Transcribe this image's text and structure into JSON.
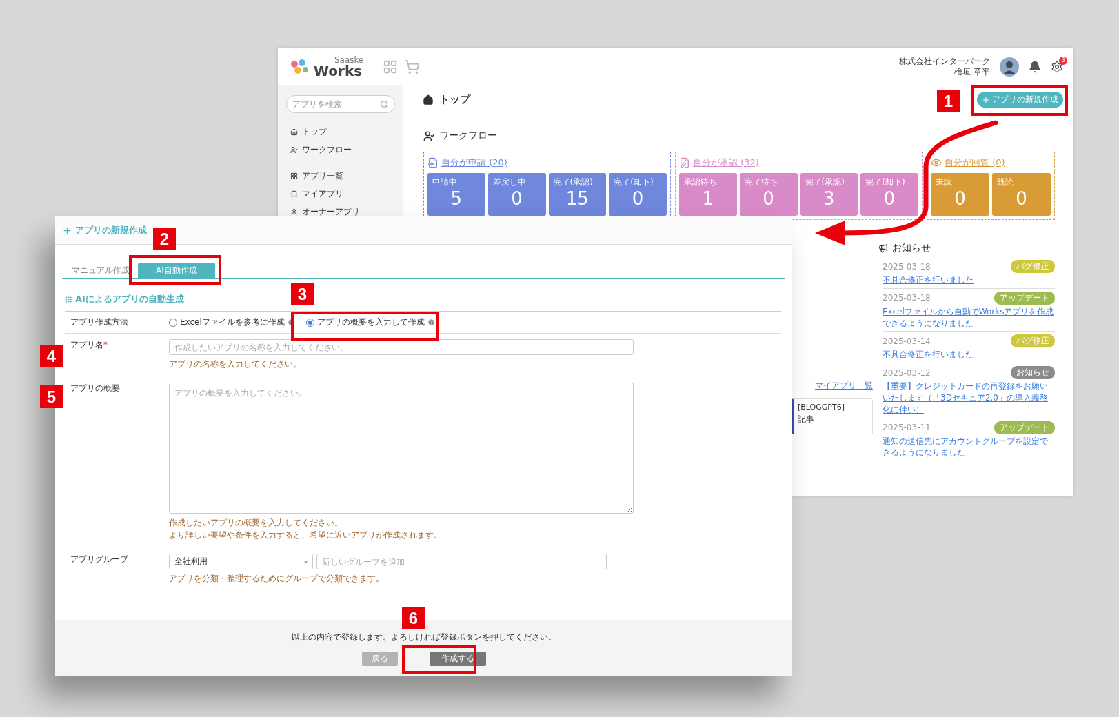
{
  "background_window": {
    "header": {
      "logo_caption": "Saaske",
      "logo": "Works",
      "company": "株式会社インターパーク",
      "user": "檜垣 章平",
      "notification_count": "3"
    },
    "sidebar": {
      "search_placeholder": "アプリを検索",
      "items": [
        {
          "label": "トップ"
        },
        {
          "label": "ワークフロー"
        },
        {
          "label": "アプリ一覧"
        },
        {
          "label": "マイアプリ"
        },
        {
          "label": "オーナーアプリ"
        }
      ]
    },
    "page_title": "トップ",
    "new_app_button": "アプリの新規作成",
    "workflow": {
      "title": "ワークフロー",
      "groups": [
        {
          "title": "自分が申請 (20)",
          "color": "#6f87dd",
          "tiles": [
            {
              "label": "申請中",
              "value": "5"
            },
            {
              "label": "差戻し中",
              "value": "0"
            },
            {
              "label": "完了(承認)",
              "value": "15"
            },
            {
              "label": "完了(却下)",
              "value": "0"
            }
          ]
        },
        {
          "title": "自分が承認 (32)",
          "color": "#d98bc9",
          "tiles": [
            {
              "label": "承認待ち",
              "value": "1"
            },
            {
              "label": "完了待ち",
              "value": "0"
            },
            {
              "label": "完了(承認)",
              "value": "3"
            },
            {
              "label": "完了(却下)",
              "value": "0"
            }
          ]
        },
        {
          "title": "自分が回覧 (0)",
          "color": "#d99b36",
          "tiles": [
            {
              "label": "未読",
              "value": "0"
            },
            {
              "label": "既読",
              "value": "0"
            }
          ]
        }
      ]
    },
    "my_apps_link": "マイアプリ一覧",
    "app_card": {
      "name": "[BLOGGPT6]",
      "category": "記事"
    },
    "news": {
      "title": "お知らせ",
      "items": [
        {
          "date": "2025-03-18",
          "tag": "バグ修正",
          "color": "#cdc83c",
          "text": "不具合修正を行いました"
        },
        {
          "date": "2025-03-18",
          "tag": "アップデート",
          "color": "#9dbb50",
          "text": "Excelファイルから自動でWorksアプリを作成できるようになりました"
        },
        {
          "date": "2025-03-14",
          "tag": "バグ修正",
          "color": "#cdc83c",
          "text": "不具合修正を行いました"
        },
        {
          "date": "2025-03-12",
          "tag": "お知らせ",
          "color": "#8c8c8c",
          "text": "【重要】クレジットカードの再登録をお願いいたします（「3Dセキュア2.0」の導入義務化に伴い）"
        },
        {
          "date": "2025-03-11",
          "tag": "アップデート",
          "color": "#9dbb50",
          "text": "通知の送信先にアカウントグループを設定できるようになりました"
        }
      ]
    }
  },
  "dialog": {
    "title": "アプリの新規作成",
    "tabs": [
      {
        "label": "マニュアル作成",
        "selected": false
      },
      {
        "label": "AI自動作成",
        "selected": true
      }
    ],
    "section_title": "AIによるアプリの自動生成",
    "method": {
      "label": "アプリ作成方法",
      "options": [
        {
          "label": "Excelファイルを参考に作成",
          "selected": false
        },
        {
          "label": "アプリの概要を入力して作成",
          "selected": true
        }
      ]
    },
    "name": {
      "label": "アプリ名",
      "required": true,
      "required_mark": "*",
      "placeholder": "作成したいアプリの名称を入力してください。",
      "hints": [
        "アプリの名称を入力してください。"
      ]
    },
    "summary": {
      "label": "アプリの概要",
      "placeholder": "アプリの概要を入力してください。",
      "hints": [
        "作成したいアプリの概要を入力してください。",
        "より詳しい要望や条件を入力すると、希望に近いアプリが作成されます。"
      ]
    },
    "group": {
      "label": "アプリグループ",
      "select_value": "全社利用",
      "placeholder": "新しいグループを追加",
      "hints": [
        "アプリを分類・整理するためにグループで分類できます。"
      ]
    },
    "footer": {
      "message": "以上の内容で登録します。よろしければ登録ボタンを押してください。",
      "back_button": "戻る",
      "create_button": "作成する"
    }
  },
  "annotations": [
    "1",
    "2",
    "3",
    "4",
    "5",
    "6"
  ]
}
